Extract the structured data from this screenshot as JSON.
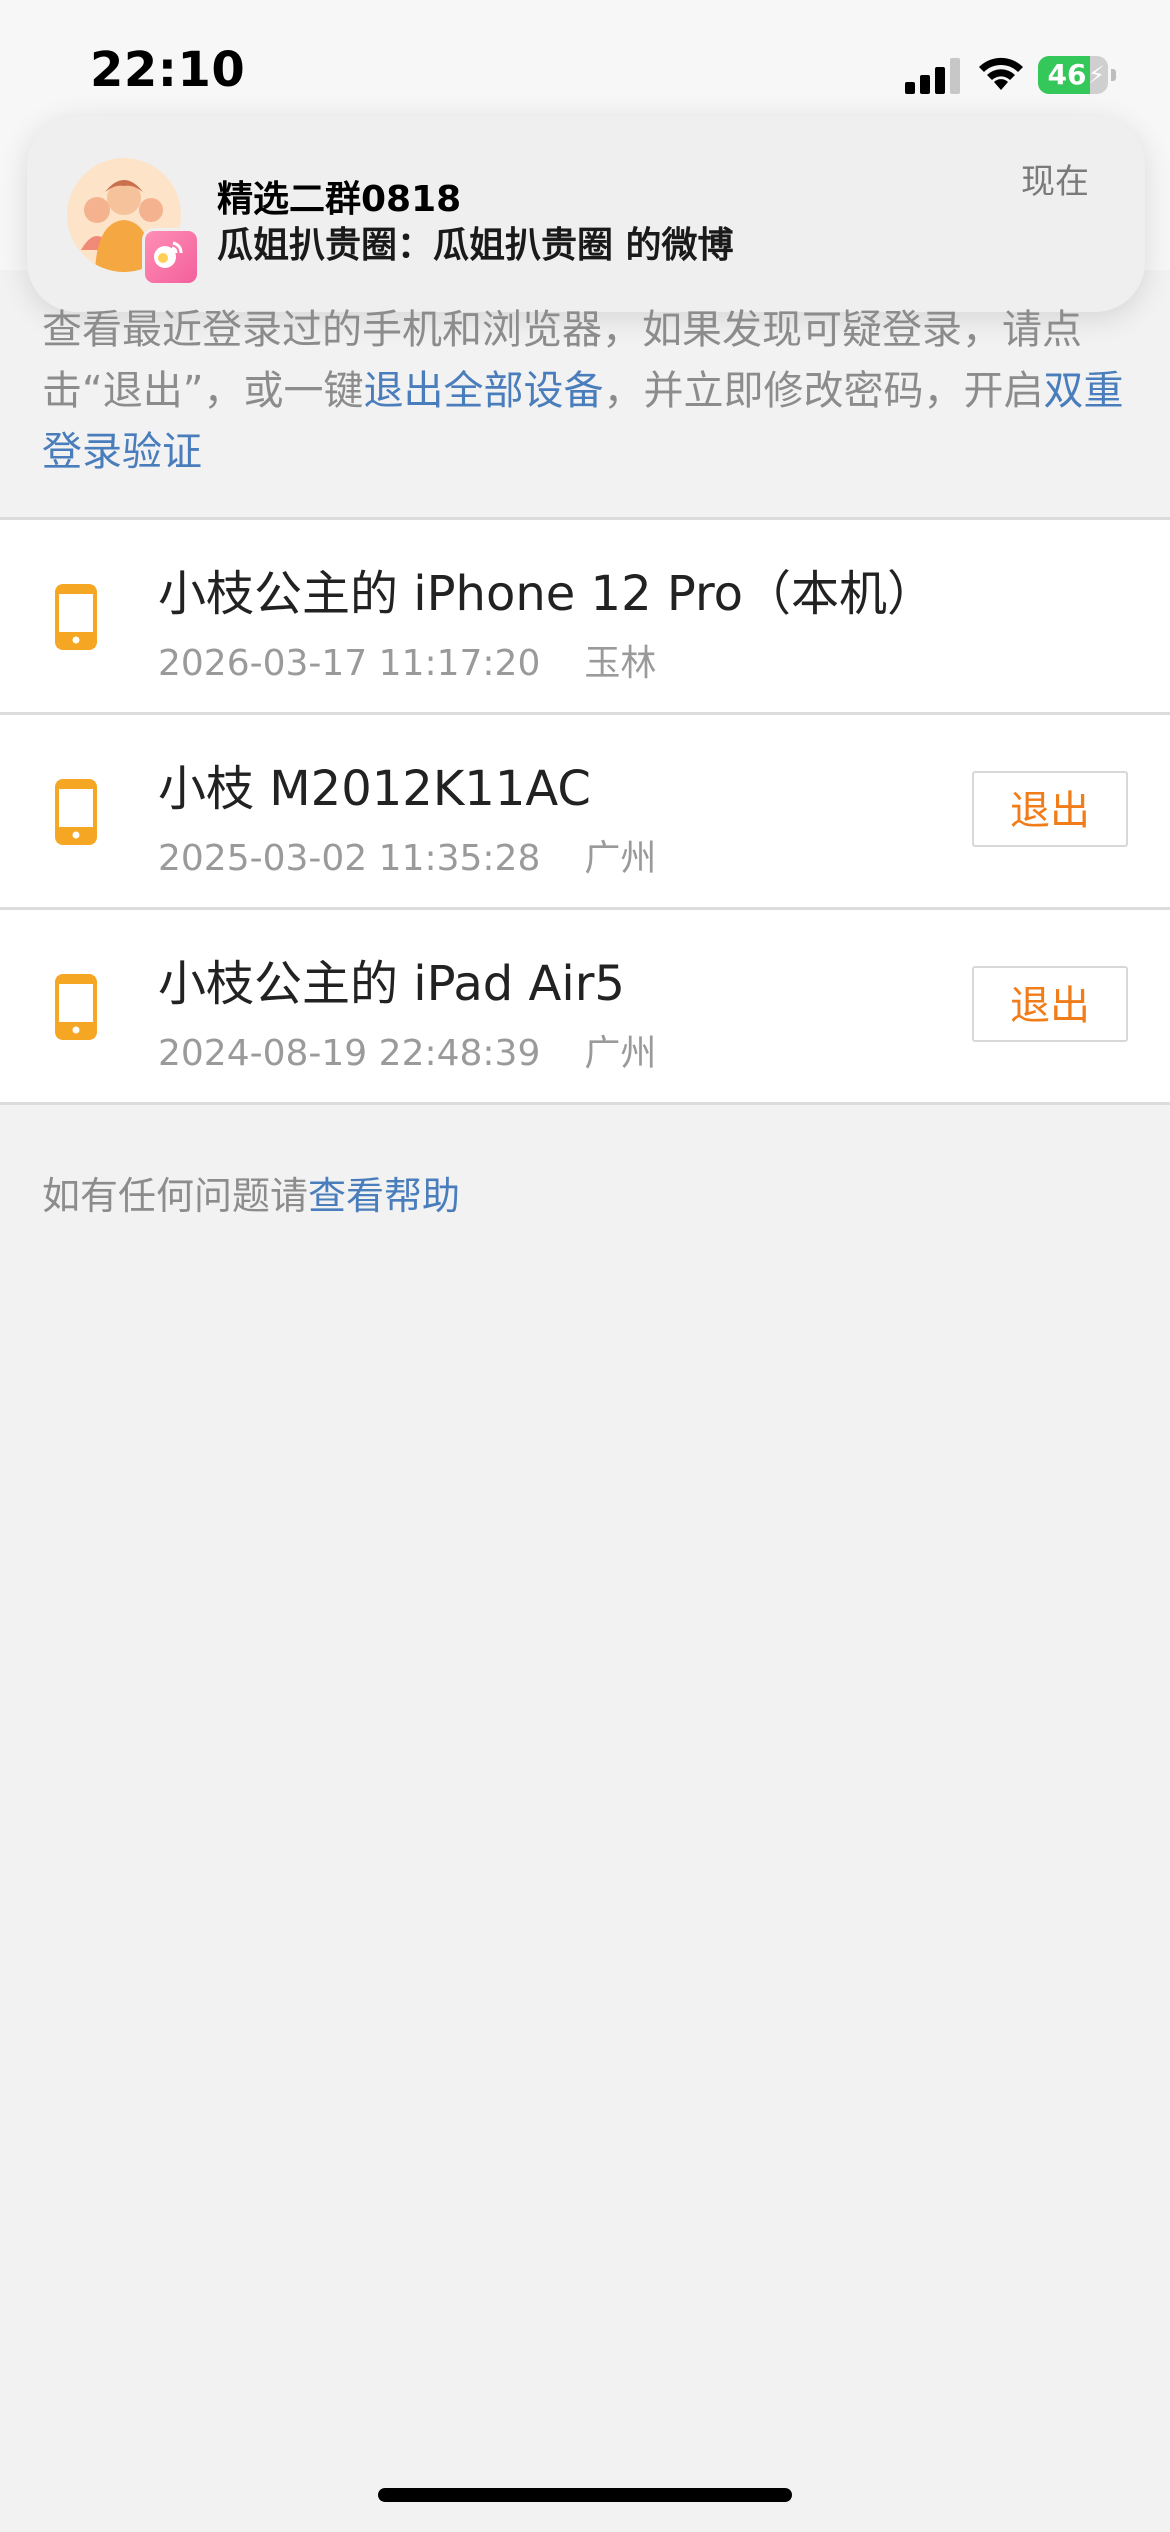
{
  "status_bar": {
    "time": "22:10",
    "battery": "46",
    "battery_level": 0.46,
    "icons": [
      "signal-icon",
      "wifi-icon",
      "battery-icon"
    ]
  },
  "notification": {
    "title": "精选二群0818",
    "body": "瓜姐扒贵圈：瓜姐扒贵圈 的微博",
    "time": "现在",
    "icons": [
      "group-avatar-icon",
      "app-badge-icon"
    ]
  },
  "intro": {
    "text_part1": "查看最近登录过的手机和浏览器，如果发现可疑登录，请点击“退出”，或一键",
    "link_logout_all": "退出全部设备",
    "text_part2": "，并立即修改密码，开启",
    "link_two_factor": "双重登录验证"
  },
  "devices": [
    {
      "name": "小枝公主的 iPhone 12 Pro（本机）",
      "datetime": "2026-03-17 11:17:20",
      "location": "玉林",
      "icon": "phone-icon"
    },
    {
      "name": "小枝 M2012K11AC",
      "datetime": "2025-03-02 11:35:28",
      "location": "广州",
      "logout_label": "退出",
      "icon": "phone-icon"
    },
    {
      "name": "小枝公主的 iPad Air5",
      "datetime": "2024-08-19 22:48:39",
      "location": "广州",
      "logout_label": "退出",
      "icon": "phone-icon"
    }
  ],
  "help": {
    "text": "如有任何问题请",
    "link": "查看帮助"
  },
  "colors": {
    "accent_link": "#4a7dbc",
    "logout_orange": "#f07d1a",
    "device_icon": "#f5a623",
    "background": "#f2f2f2"
  }
}
